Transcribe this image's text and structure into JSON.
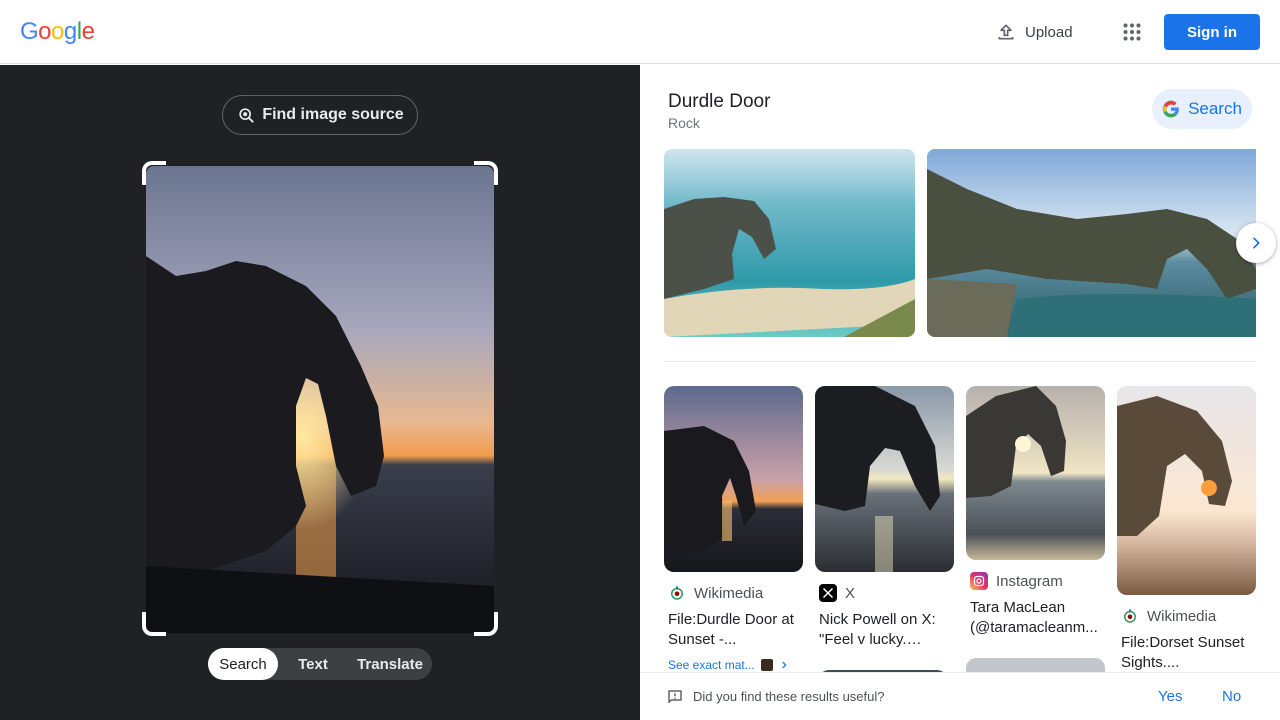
{
  "header": {
    "logo_letters": [
      "G",
      "o",
      "o",
      "g",
      "l",
      "e"
    ],
    "logo_colors": [
      "#4285F4",
      "#EA4335",
      "#FBBC05",
      "#4285F4",
      "#34A853",
      "#EA4335"
    ],
    "upload_label": "Upload",
    "apps_icon": "apps-grid-icon",
    "signin_label": "Sign in"
  },
  "left": {
    "find_source_label": "Find image source",
    "modes": [
      {
        "label": "Search",
        "active": true
      },
      {
        "label": "Text",
        "active": false
      },
      {
        "label": "Translate",
        "active": false
      }
    ]
  },
  "right": {
    "entity": {
      "title": "Durdle Door",
      "subtitle": "Rock"
    },
    "search_button_label": "Search",
    "results": [
      {
        "source": "Wikimedia",
        "title": "File:Durdle Door at Sunset -...",
        "exact_match_label": "See exact mat..."
      },
      {
        "source": "X",
        "title": "Nick Powell on X: \"Feel v lucky. Four..."
      },
      {
        "source": "Instagram",
        "title": "Tara MacLean (@taramacleanm..."
      },
      {
        "source": "Wikimedia",
        "title": "File:Dorset Sunset Sights...."
      }
    ]
  },
  "feedback": {
    "question": "Did you find these results useful?",
    "yes": "Yes",
    "no": "No"
  },
  "colors": {
    "accent": "#1a73e8",
    "dark_pane": "#202124"
  }
}
